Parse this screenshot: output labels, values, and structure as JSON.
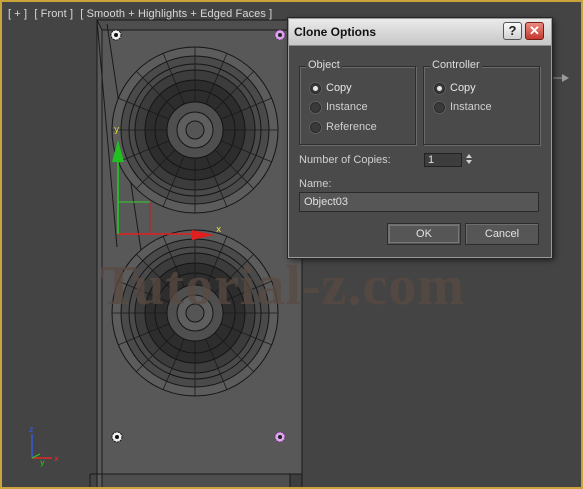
{
  "viewport": {
    "label_parts": [
      "[ + ]",
      "[ Front ]",
      "[ Smooth + Highlights + Edged Faces ]"
    ],
    "axis_labels": {
      "x": "x",
      "y": "y",
      "z": "z"
    },
    "watermark": "Tutorial-z.com"
  },
  "dialog": {
    "title": "Clone Options",
    "help_label": "?",
    "close_label": "✕",
    "object_group": {
      "label": "Object",
      "options": [
        {
          "label": "Copy",
          "selected": true
        },
        {
          "label": "Instance",
          "selected": false
        },
        {
          "label": "Reference",
          "selected": false
        }
      ]
    },
    "controller_group": {
      "label": "Controller",
      "options": [
        {
          "label": "Copy",
          "selected": true
        },
        {
          "label": "Instance",
          "selected": false
        }
      ]
    },
    "copies_label": "Number of Copies:",
    "copies_value": "1",
    "name_label": "Name:",
    "name_value": "Object03",
    "ok_label": "OK",
    "cancel_label": "Cancel"
  },
  "colors": {
    "viewport_border": "#c9a43a",
    "viewport_bg": "#444444",
    "axis_x": "#ff2020",
    "axis_y": "#20d020",
    "axis_z": "#3060ff"
  }
}
